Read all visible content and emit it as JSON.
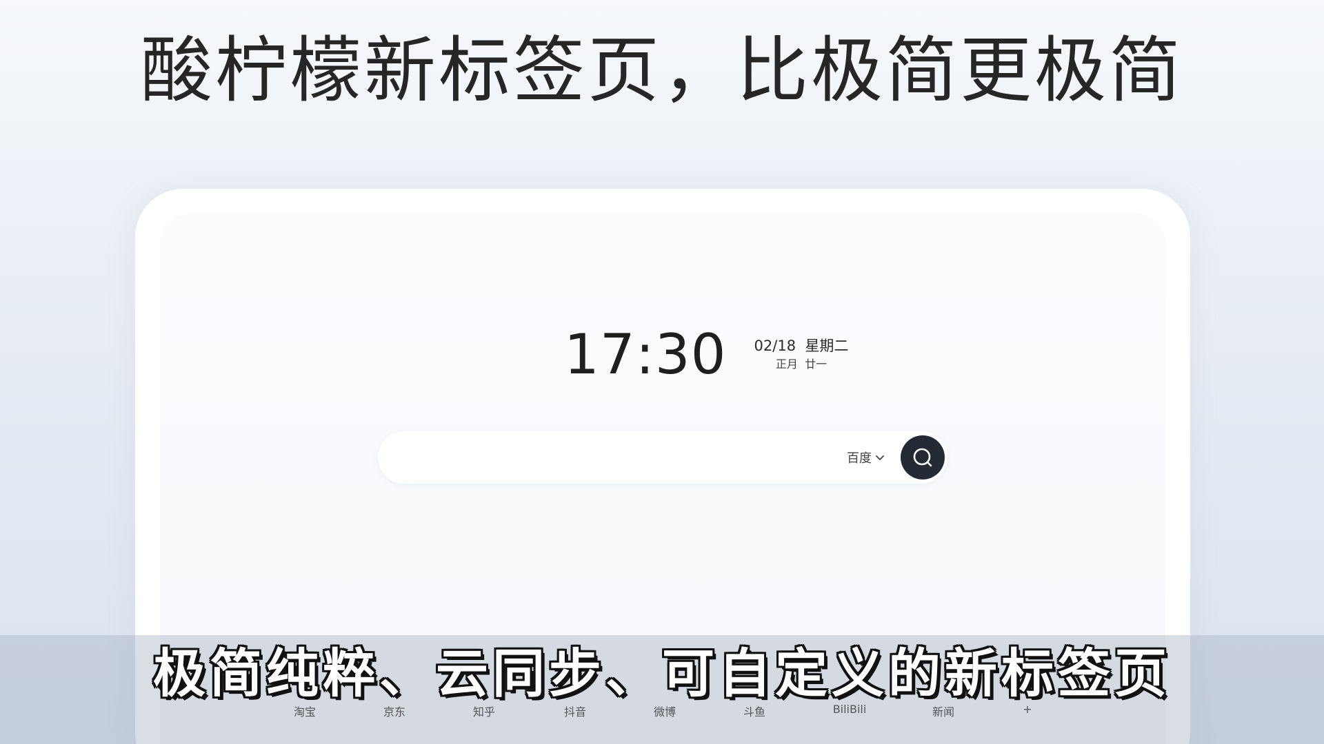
{
  "headline": "酸柠檬新标签页，比极简更极简",
  "clock": {
    "time": "17:30",
    "date": "02/18",
    "weekday": "星期二",
    "lunar_month": "正月",
    "lunar_day": "廿一"
  },
  "search": {
    "value": "",
    "engine": "百度",
    "icon": "search-icon"
  },
  "quick_links": [
    {
      "label": "淘宝"
    },
    {
      "label": "京东"
    },
    {
      "label": "知乎"
    },
    {
      "label": "抖音"
    },
    {
      "label": "微博"
    },
    {
      "label": "斗鱼"
    },
    {
      "label": "BiliBili"
    },
    {
      "label": "新闻"
    },
    {
      "label": "+"
    }
  ],
  "caption": "极简纯粹、云同步、可自定义的新标签页",
  "colors": {
    "search_button": "#232a33",
    "caption_text": "#ffffff",
    "caption_outline": "#111111"
  }
}
